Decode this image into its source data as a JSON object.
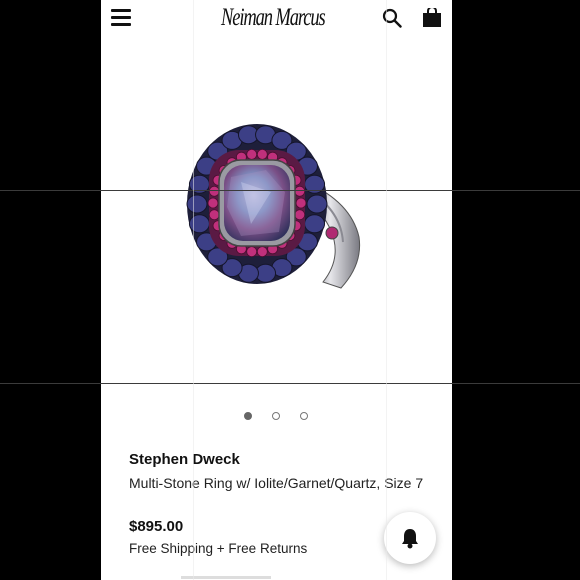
{
  "header": {
    "logo_text": "Neiman Marcus",
    "menu_icon": "hamburger-menu-icon",
    "search_icon": "search-icon",
    "bag_icon": "shopping-bag-icon"
  },
  "gallery": {
    "image_alt": "Multi-stone ring with iolite, garnet and quartz",
    "total_slides": 3,
    "active_slide": 1
  },
  "product": {
    "designer": "Stephen Dweck",
    "title": "Multi-Stone Ring w/ Iolite/Garnet/Quartz, Size 7",
    "price": "$895.00",
    "shipping": "Free Shipping + Free Returns"
  },
  "actions": {
    "notify_icon": "bell-icon"
  },
  "colors": {
    "text": "#111111",
    "iolite": "#3c3f86",
    "garnet": "#c0307c",
    "quartz": "#5e86bf",
    "silver": "#c9c9cf"
  }
}
